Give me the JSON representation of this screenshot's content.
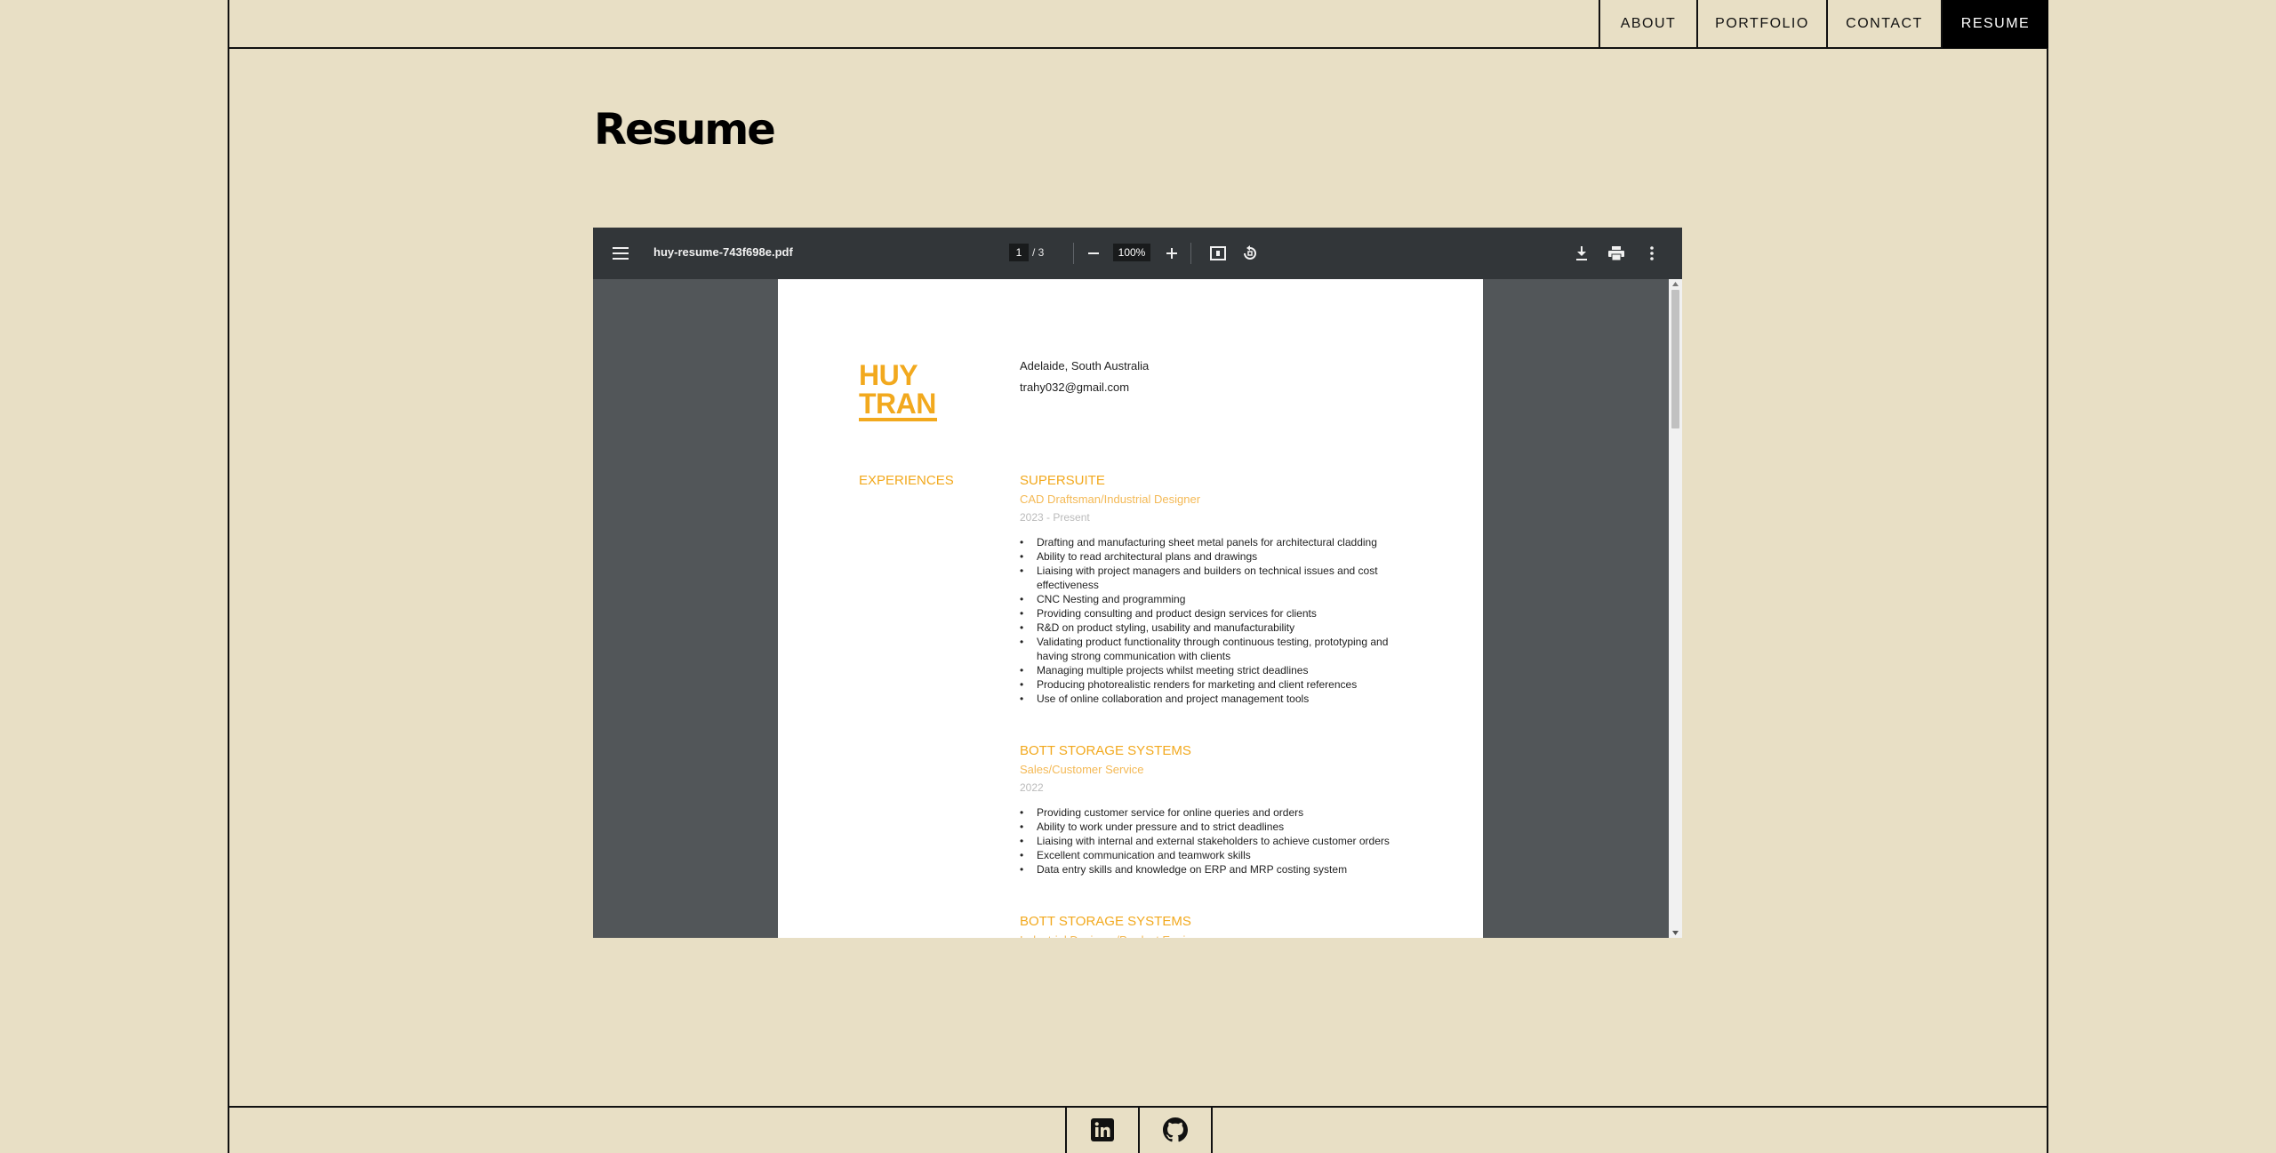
{
  "nav": {
    "items": [
      {
        "label": "ABOUT"
      },
      {
        "label": "PORTFOLIO"
      },
      {
        "label": "CONTACT"
      },
      {
        "label": "RESUME",
        "active": true
      }
    ]
  },
  "page_title": "Resume",
  "pdf_viewer": {
    "filename": "huy-resume-743f698e.pdf",
    "current_page": "1",
    "page_of": "/ 3",
    "zoom": "100%",
    "icons": [
      "menu-icon",
      "zoom-out-icon",
      "zoom-in-icon",
      "fit-page-icon",
      "rotate-icon",
      "download-icon",
      "print-icon",
      "more-vert-icon"
    ]
  },
  "resume": {
    "first_name": "HUY",
    "last_name": "TRAN",
    "location": "Adelaide, South Australia",
    "email": "trahy032@gmail.com",
    "section_title": "EXPERIENCES",
    "jobs": [
      {
        "company": "SUPERSUITE",
        "role": "CAD Draftsman/Industrial Designer",
        "years": "2023 - Present",
        "bullets": [
          "Drafting and manufacturing sheet metal panels for architectural cladding",
          "Ability to read architectural plans and drawings",
          "Liaising with project managers and builders on technical issues and cost effectiveness",
          "CNC Nesting and programming",
          "Providing consulting and product design services for clients",
          "R&D on product styling, usability and manufacturability",
          "Validating product functionality through continuous testing, prototyping and having strong communication with clients",
          "Managing multiple projects whilst meeting strict deadlines",
          "Producing photorealistic renders for marketing and client references",
          "Use of online collaboration and project management tools"
        ]
      },
      {
        "company": "BOTT STORAGE SYSTEMS",
        "role": "Sales/Customer Service",
        "years": "2022",
        "bullets": [
          "Providing customer service for online queries and orders",
          "Ability to work under pressure and to strict deadlines",
          "Liaising with internal and external stakeholders to achieve customer orders",
          "Excellent communication and teamwork skills",
          "Data entry skills and knowledge on ERP and MRP costing system"
        ]
      },
      {
        "company": "BOTT STORAGE SYSTEMS",
        "role": "Industrial Designer/Product Engineer"
      }
    ]
  },
  "footer": {
    "icons": [
      "linkedin-icon",
      "github-icon"
    ]
  }
}
